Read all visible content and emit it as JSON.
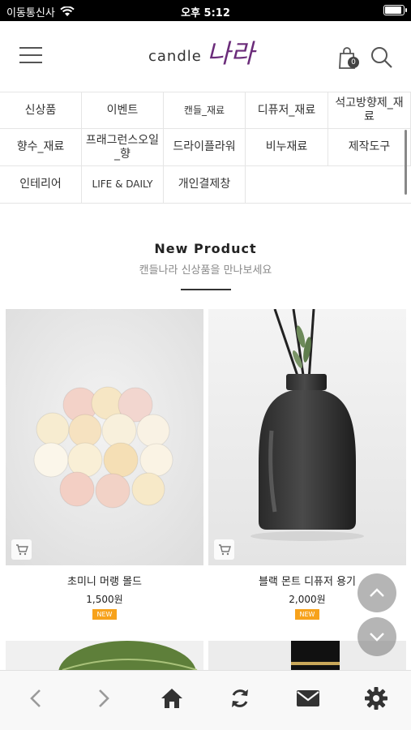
{
  "status_bar": {
    "carrier": "이동통신사",
    "time": "오후 5:12",
    "wifi_icon": "wifi-icon",
    "battery_icon": "battery-icon"
  },
  "header": {
    "menu_icon": "hamburger-menu-icon",
    "logo_latin": "candle",
    "logo_korean": "나라",
    "cart_icon": "shopping-bag-icon",
    "cart_count": "0",
    "search_icon": "search-icon",
    "brand_color": "#6b2c7a"
  },
  "categories": {
    "row1": [
      "신상품",
      "이벤트",
      "캔들_재료",
      "디퓨저_재료",
      "석고방향제_재료"
    ],
    "row2": [
      "향수_재료",
      "프래그런스오일_향",
      "드라이플라워",
      "비누재료",
      "제작도구"
    ],
    "row3": [
      "인테리어",
      "LIFE & DAILY",
      "개인결제창"
    ]
  },
  "section": {
    "title": "New Product",
    "subtitle": "캔들나라 신상품을 만나보세요"
  },
  "products": [
    {
      "name": "초미니 머랭 몰드",
      "price": "1,500원",
      "badge": "NEW",
      "cart_icon": "add-to-cart-icon"
    },
    {
      "name": "블랙 몬트 디퓨저 용기",
      "price": "2,000원",
      "badge": "NEW",
      "cart_icon": "add-to-cart-icon"
    }
  ],
  "floating": {
    "up_icon": "chevron-up-icon",
    "down_icon": "chevron-down-icon"
  },
  "bottom_nav": {
    "back_icon": "back-arrow-icon",
    "forward_icon": "forward-arrow-icon",
    "home_icon": "home-icon",
    "refresh_icon": "refresh-icon",
    "mail_icon": "mail-icon",
    "settings_icon": "gear-icon"
  },
  "colors": {
    "badge_orange": "#f7a21b",
    "nav_icon": "#333333"
  }
}
